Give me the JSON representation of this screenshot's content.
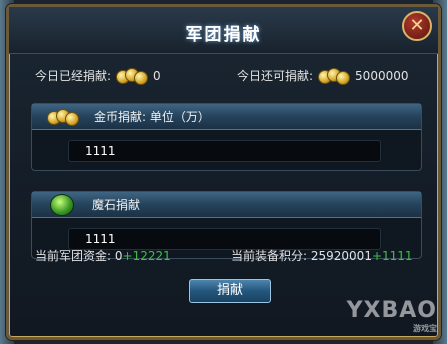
{
  "dialog": {
    "title": "军团捐献",
    "close_symbol": "✕"
  },
  "today": {
    "donated_label": "今日已经捐献:",
    "donated_value": "0",
    "remaining_label": "今日还可捐献:",
    "remaining_value": "5000000"
  },
  "gold_section": {
    "header": "金币捐献: 单位（万）",
    "input_value": "1111"
  },
  "stone_section": {
    "header": "魔石捐献",
    "input_value": "1111"
  },
  "footer": {
    "funds_label": "当前军团资金:",
    "funds_value": "0",
    "funds_bonus": "+12221",
    "points_label": "当前装备积分:",
    "points_value": "25920001",
    "points_bonus": "+1111"
  },
  "donate_button": "捐献",
  "watermark": {
    "brand": "YXBAO",
    "sub": "游戏宝"
  },
  "colors": {
    "bonus_green": "#39c43a",
    "frame_gold": "#c9a860",
    "button_blue": "#24577e"
  }
}
